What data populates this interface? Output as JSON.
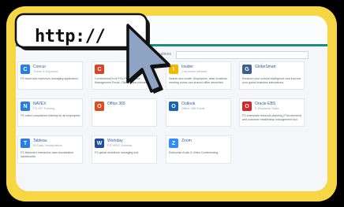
{
  "url_bubble": {
    "text": "http://"
  },
  "portal": {
    "search_label": "Applications",
    "search_placeholder": ""
  },
  "apps": [
    {
      "name": "Concur",
      "subtitle": "Travel & Expense",
      "description": "FS travel and expenses managing application.",
      "icon": "concur-icon",
      "color": "#2a7de1",
      "glyph": "C"
    },
    {
      "name": "",
      "subtitle": "",
      "description": "CornerstoneOn is FS's Performance Management Portal. Click to view policies.",
      "icon": "cornerstone-icon",
      "color": "#d5462b",
      "glyph": "C"
    },
    {
      "name": "Insider",
      "subtitle": "Corporate intranet",
      "description": "Search and locate: Employees, desk locations, meeting rooms and shared office amenities.",
      "icon": "insider-icon",
      "color": "#f2b705",
      "glyph": "I"
    },
    {
      "name": "GlobeSmart",
      "subtitle": "",
      "description": "Enhance your cultural intelligence and improve your global business interactions.",
      "icon": "globesmart-icon",
      "color": "#3b5f8f",
      "glyph": "G"
    },
    {
      "name": "NAVEX",
      "subtitle": "FS HR Training",
      "description": "FS online compliance training for all employees.",
      "icon": "navex-icon",
      "color": "#2a7de1",
      "glyph": "N"
    },
    {
      "name": "Office 365",
      "subtitle": "",
      "description": "",
      "icon": "office-365-icon",
      "color": "#e04b1f",
      "glyph": "O"
    },
    {
      "name": "Outlook",
      "subtitle": "Office 365 Email",
      "description": "",
      "icon": "outlook-icon",
      "color": "#1a64b5",
      "glyph": "O"
    },
    {
      "name": "Oracle EBS",
      "subtitle": "E-Business Suite",
      "description": "FS enterprise resource planning (Procurement) and customer relationship management tool.",
      "icon": "oracle-icon",
      "color": "#d6262a",
      "glyph": "O"
    },
    {
      "name": "Tableau",
      "subtitle": "BI Data Visualization",
      "description": "FS Network's interactive data visualization dashboards.",
      "icon": "tableau-icon",
      "color": "#2a7de1",
      "glyph": "T"
    },
    {
      "name": "Workday",
      "subtitle": "FS HRIS Solution",
      "description": "FS global workforce managing tool.",
      "icon": "workday-icon",
      "color": "#1f4e9c",
      "glyph": "W"
    },
    {
      "name": "Zoom",
      "subtitle": "",
      "description": "Enterprise Audio & Video Conferencing.",
      "icon": "zoom-icon",
      "color": "#2d8cff",
      "glyph": "Z"
    }
  ]
}
